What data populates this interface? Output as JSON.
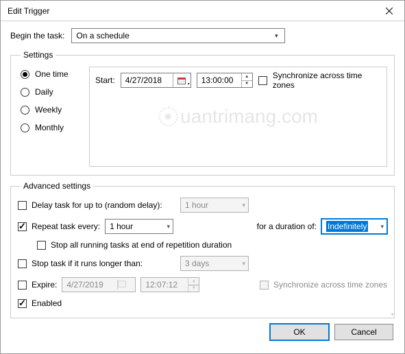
{
  "window": {
    "title": "Edit Trigger"
  },
  "beginTask": {
    "label": "Begin the task:",
    "value": "On a schedule"
  },
  "settings": {
    "legend": "Settings",
    "options": {
      "oneTime": "One time",
      "daily": "Daily",
      "weekly": "Weekly",
      "monthly": "Monthly",
      "selected": "oneTime"
    },
    "start": {
      "label": "Start:",
      "date": "4/27/2018",
      "time": "13:00:00",
      "syncLabel": "Synchronize across time zones",
      "syncChecked": false
    }
  },
  "advanced": {
    "legend": "Advanced settings",
    "delay": {
      "checked": false,
      "label": "Delay task for up to (random delay):",
      "value": "1 hour"
    },
    "repeat": {
      "checked": true,
      "label": "Repeat task every:",
      "value": "1 hour",
      "durationLabel": "for a duration of:",
      "durationValue": "Indefinitely"
    },
    "stopRepetition": {
      "checked": false,
      "label": "Stop all running tasks at end of repetition duration"
    },
    "stopLong": {
      "checked": false,
      "label": "Stop task if it runs longer than:",
      "value": "3 days"
    },
    "expire": {
      "checked": false,
      "label": "Expire:",
      "date": "4/27/2019",
      "time": "12:07:12",
      "syncLabel": "Synchronize across time zones"
    },
    "enabled": {
      "checked": true,
      "label": "Enabled"
    }
  },
  "buttons": {
    "ok": "OK",
    "cancel": "Cancel"
  },
  "watermark": "uantrimang.com"
}
